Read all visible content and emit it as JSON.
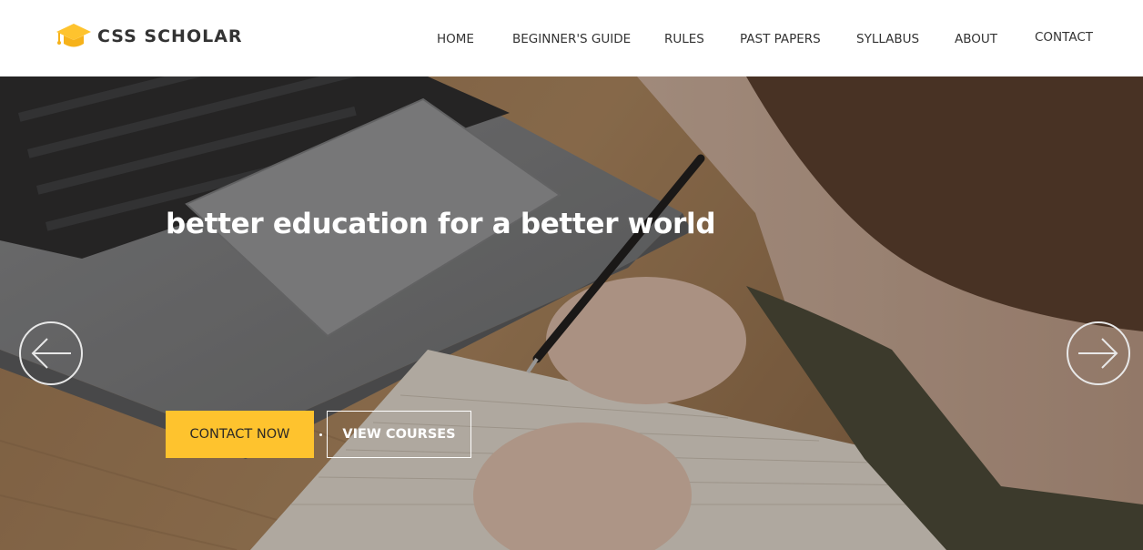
{
  "brand": {
    "name": "CSS SCHOLAR",
    "logo_icon": "graduation-cap-icon",
    "accent": "#fec32e"
  },
  "nav": {
    "items": [
      {
        "label": "HOME"
      },
      {
        "label": "BEGINNER'S GUIDE"
      },
      {
        "label": "RULES"
      },
      {
        "label": "PAST PAPERS"
      },
      {
        "label": "SYLLABUS"
      },
      {
        "label": "ABOUT"
      },
      {
        "label": "CONTACT"
      }
    ]
  },
  "hero": {
    "headline": "better education for a better world",
    "primary_button": "CONTACT NOW",
    "secondary_button": "VIEW COURSES",
    "prev_icon": "arrow-left-circle-icon",
    "next_icon": "arrow-right-circle-icon"
  }
}
